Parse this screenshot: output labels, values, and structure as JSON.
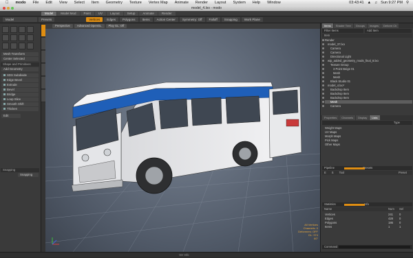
{
  "menubar": {
    "app": "modo",
    "items": [
      "File",
      "Edit",
      "View",
      "Select",
      "Item",
      "Geometry",
      "Texture",
      "Vertex Map",
      "Animate",
      "Render",
      "Layout",
      "System",
      "Help",
      "Window"
    ],
    "clock": "Sun 9:27 PM",
    "time_small": "03:43:41"
  },
  "window": {
    "title": "model_4.lxo - modo"
  },
  "tabs": [
    "Model",
    "Model Mod",
    "Paint",
    "UV",
    "Layout",
    "Setup",
    "Animate",
    "Render"
  ],
  "toolbar": {
    "layout_label": "Model",
    "presets": "Presets",
    "vertices": "Vertices",
    "edges": "Edges",
    "polygons": "Polygons",
    "items": "Items",
    "action_center": "Action Center",
    "symmetry": "Symmetry: Off",
    "falloff": "Falloff",
    "snapping": "Snapping",
    "work_plane": "Work Plane"
  },
  "left_panel": {
    "mesh_transform": "Mesh Transform",
    "center_selected": "Center Selected",
    "shape_section": "Shape and Primitives",
    "add_geometry": "Add Geometry",
    "tools": [
      "SDS Subdivide",
      "Edge Bevel",
      "Extrude",
      "Bevel",
      "Bridge",
      "Loop Slice",
      "Smooth Shift",
      "Thicken"
    ],
    "edit": "Edit",
    "snapping_header": "Snapping",
    "snapping_value": "Snapping"
  },
  "viewport": {
    "buttons": [
      "Perspective",
      "Advanced OpenGL",
      "Play GL: Off"
    ],
    "info": [
      "All Vertices",
      "Channels: 0",
      "Deformers: OFF",
      "GL: 974",
      "60\""
    ]
  },
  "right_panel": {
    "top_tabs": [
      "Items",
      "Shader Tree",
      "Groups",
      "Images",
      "Deform Ch"
    ],
    "filter_label": "Filter Items",
    "add_item": "Add Item",
    "items_header": "Item",
    "tree": [
      {
        "label": "Render",
        "sel": false
      },
      {
        "label": "model_37.lxo",
        "sel": false
      },
      {
        "label": "Camera",
        "sel": false
      },
      {
        "label": "Camera",
        "sel": false
      },
      {
        "label": "Directional Light",
        "sel": false
      },
      {
        "label": "wip_added_geometry_mods_final_8.lxo",
        "sel": false
      },
      {
        "label": "Texture Group",
        "sel": false
      },
      {
        "label": "3 Point Beige 01",
        "sel": false
      },
      {
        "label": "Mesh",
        "sel": false
      },
      {
        "label": "Mesh",
        "sel": false
      },
      {
        "label": "Black Studio 01",
        "sel": false
      },
      {
        "label": "model_4.lxo*",
        "sel": false
      },
      {
        "label": "Backdrop Item",
        "sel": false
      },
      {
        "label": "Backdrop Item",
        "sel": false
      },
      {
        "label": "Backdrop Item",
        "sel": false
      },
      {
        "label": "Mesh",
        "sel": true
      },
      {
        "label": "Camera",
        "sel": false
      }
    ],
    "mid_tabs": [
      "Properties",
      "Channels",
      "Display",
      "Lists"
    ],
    "lists": [
      "Weight Maps",
      "UV Maps",
      "Morph Maps",
      "Pick Maps",
      "Other Maps"
    ],
    "lists_type": "Type",
    "pipeline": "Pipeline",
    "presets": "Presets",
    "pipeline_cols": [
      "E",
      "S",
      "Tool",
      "Preset"
    ],
    "statistics": "Statistics",
    "stats_info": "Info",
    "stats_cols": [
      "Name",
      "Num",
      "Sel"
    ],
    "stats": [
      {
        "name": "Vertices",
        "num": "241",
        "sel": "0"
      },
      {
        "name": "Edges",
        "num": "428",
        "sel": "0"
      },
      {
        "name": "Polygons",
        "num": "186",
        "sel": "0"
      },
      {
        "name": "Items",
        "num": "1",
        "sel": "1"
      }
    ],
    "command": "Command"
  },
  "status": {
    "text": "Ver Info"
  },
  "colors": {
    "accent": "#e08e12",
    "van_blue": "#1f5fb8",
    "van_body": "#e9eaec"
  }
}
